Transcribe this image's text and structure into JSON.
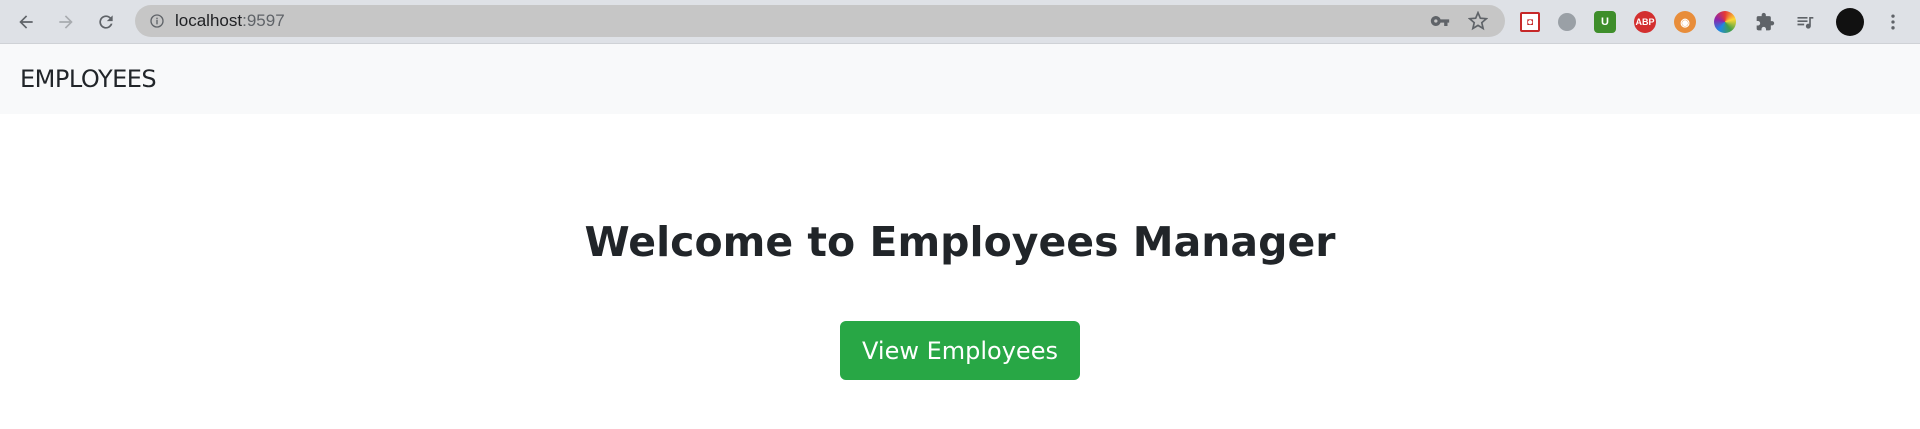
{
  "browser": {
    "url_host": "localhost",
    "url_port": ":9597",
    "icons": [
      "back-icon",
      "forward-icon",
      "reload-icon",
      "info-icon",
      "key-icon",
      "star-icon"
    ],
    "extensions": [
      {
        "name": "pdf-extension-icon",
        "text": "",
        "color": "#c62828"
      },
      {
        "name": "messenger-extension-icon",
        "text": "",
        "color": "#9aa0a6"
      },
      {
        "name": "upwork-extension-icon",
        "text": "U",
        "color": "#3e8e2b"
      },
      {
        "name": "adblock-extension-icon",
        "text": "ABP",
        "color": "#d32f2f"
      },
      {
        "name": "eyes-extension-icon",
        "text": "",
        "color": "#e88d3a"
      },
      {
        "name": "color-extension-icon",
        "text": "",
        "color": "#1e88e5"
      }
    ]
  },
  "navbar": {
    "brand": "EMPLOYEES"
  },
  "main": {
    "title": "Welcome to Employees Manager",
    "button_label": "View Employees",
    "button_color": "#28a745"
  }
}
